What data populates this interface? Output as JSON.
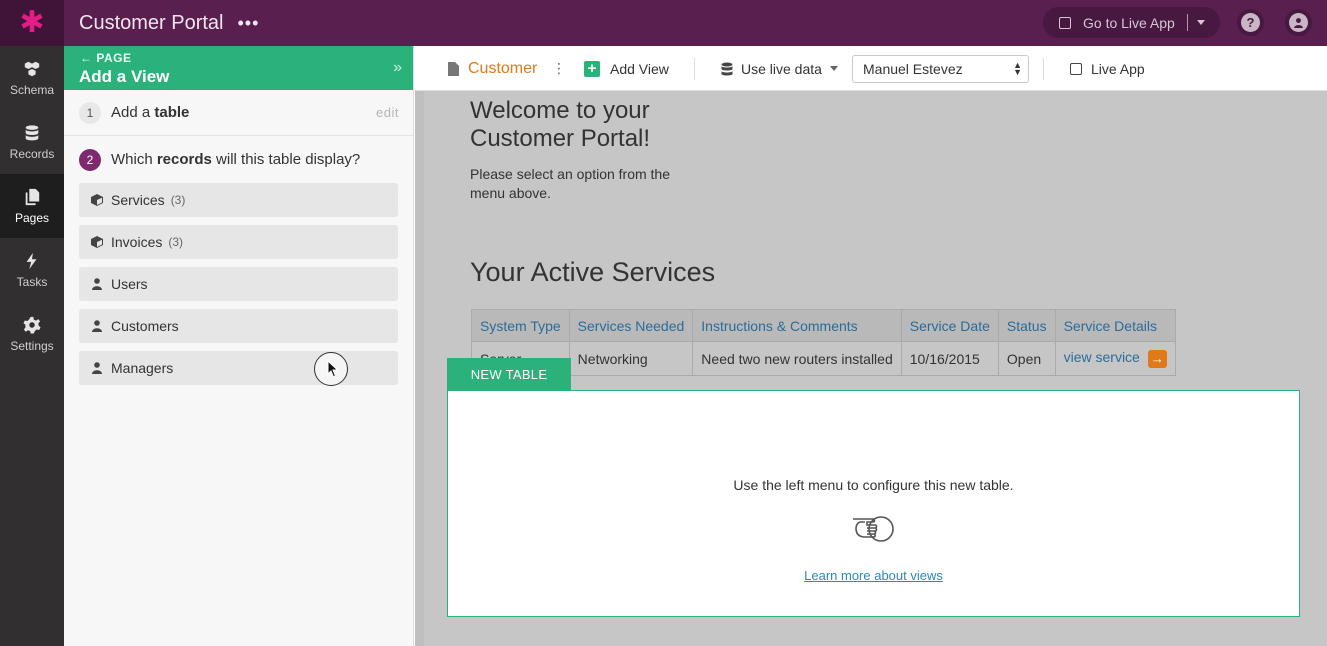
{
  "app": {
    "logo": "asterisk-logo",
    "title": "Customer Portal",
    "more": "•••",
    "go_live_label": "Go to Live App",
    "help_icon": "?",
    "account_icon": "account-icon"
  },
  "nav": {
    "items": [
      {
        "label": "Schema",
        "icon": "schema-icon"
      },
      {
        "label": "Records",
        "icon": "database-icon"
      },
      {
        "label": "Pages",
        "icon": "pages-icon",
        "active": true
      },
      {
        "label": "Tasks",
        "icon": "lightning-icon"
      },
      {
        "label": "Settings",
        "icon": "gear-icon"
      }
    ]
  },
  "panel": {
    "crumb": "PAGE",
    "title": "Add a View",
    "collapse": "»",
    "step1": {
      "num": "1",
      "prefix": "Add a ",
      "bold": "table",
      "edit": "edit"
    },
    "step2": {
      "num": "2",
      "prefix": "Which ",
      "bold": "records",
      "suffix": " will this table display?"
    },
    "records": [
      {
        "label": "Services",
        "count": "(3)",
        "icon": "cube-icon"
      },
      {
        "label": "Invoices",
        "count": "(3)",
        "icon": "cube-icon"
      },
      {
        "label": "Users",
        "count": "",
        "icon": "person-icon"
      },
      {
        "label": "Customers",
        "count": "",
        "icon": "person-icon"
      },
      {
        "label": "Managers",
        "count": "",
        "icon": "person-icon"
      }
    ]
  },
  "toolbar": {
    "page_name": "Customer",
    "add_view": "Add View",
    "use_live_data": "Use live data",
    "user_select": "Manuel Estevez",
    "live_app": "Live App"
  },
  "canvas": {
    "welcome_title": "Welcome to your Customer Portal!",
    "welcome_sub": "Please select an option from the menu above.",
    "services_title": "Your Active Services",
    "table": {
      "headers": [
        "System Type",
        "Services Needed",
        "Instructions & Comments",
        "Service Date",
        "Status",
        "Service Details"
      ],
      "row": [
        "Server",
        "Networking",
        "Need two new routers installed",
        "10/16/2015",
        "Open",
        "view service"
      ]
    },
    "new_table_tag": "NEW TABLE",
    "new_table_msg": "Use the left menu to configure this new table.",
    "learn_more": "Learn more about views"
  },
  "colors": {
    "topbar": "#581f4f",
    "accent_green": "#2ab27a",
    "accent_orange": "#e07a18",
    "link_blue": "#2b6c99"
  }
}
